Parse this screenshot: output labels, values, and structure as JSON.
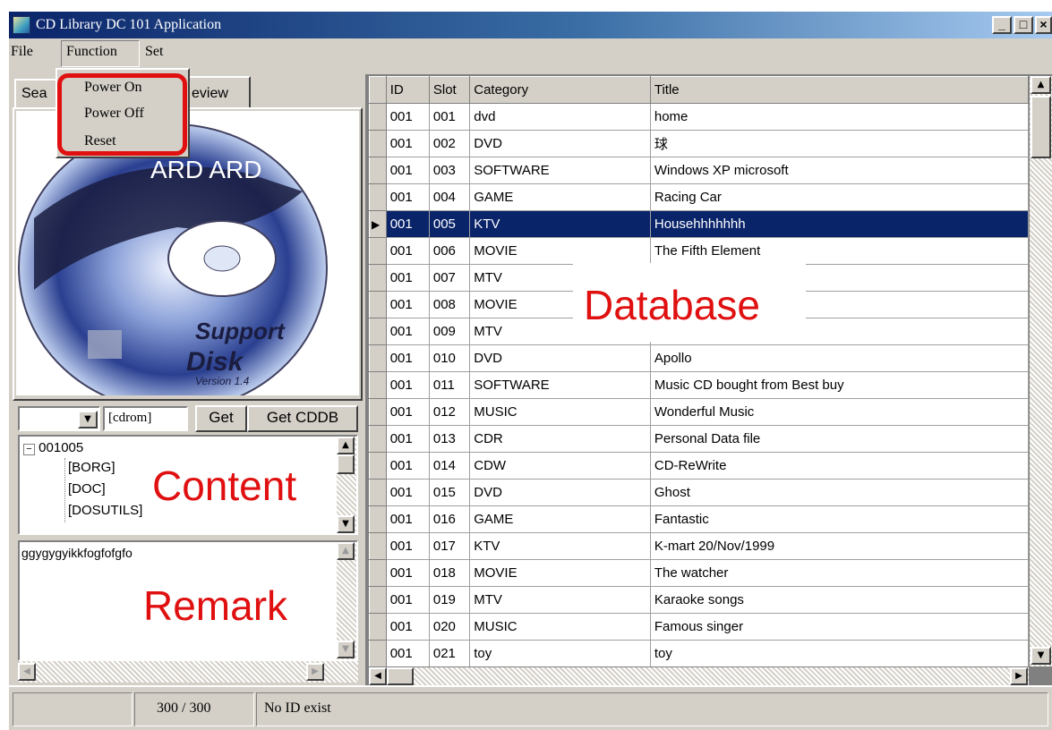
{
  "window": {
    "title": "CD Library DC 101 Application",
    "controls": {
      "minimize": "_",
      "maximize": "□",
      "close": "×"
    }
  },
  "menu": {
    "file": "File",
    "function": "Function",
    "set": "Set",
    "function_items": [
      "Power On",
      "Power Off",
      "Reset"
    ]
  },
  "left_panel": {
    "tab_search": "Sea",
    "tab_preview": "eview",
    "disc_image": {
      "brand": "ARD ARD",
      "text1": "Support",
      "text2": "Disk",
      "text3": "Version 1.4"
    },
    "drive_select": "",
    "drive_field": "[cdrom]",
    "get_button": "Get",
    "get_cddb_button": "Get CDDB",
    "tree": {
      "root": "001005",
      "children": [
        "[BORG]",
        "[DOC]",
        "[DOSUTILS]"
      ]
    },
    "content_label": "Content",
    "remark_text": "ggygygyikkfogfofgfo",
    "remark_label": "Remark"
  },
  "grid": {
    "columns": [
      "ID",
      "Slot",
      "Category",
      "Title"
    ],
    "selected_index": 4,
    "rows": [
      {
        "id": "001",
        "slot": "001",
        "category": "dvd",
        "title": "home"
      },
      {
        "id": "001",
        "slot": "002",
        "category": "DVD",
        "title": "球"
      },
      {
        "id": "001",
        "slot": "003",
        "category": "SOFTWARE",
        "title": "Windows XP microsoft"
      },
      {
        "id": "001",
        "slot": "004",
        "category": "GAME",
        "title": "Racing Car"
      },
      {
        "id": "001",
        "slot": "005",
        "category": "KTV",
        "title": "Househhhhhhh"
      },
      {
        "id": "001",
        "slot": "006",
        "category": "MOVIE",
        "title": "The Fifth Element"
      },
      {
        "id": "001",
        "slot": "007",
        "category": "MTV",
        "title": ""
      },
      {
        "id": "001",
        "slot": "008",
        "category": "MOVIE",
        "title": ""
      },
      {
        "id": "001",
        "slot": "009",
        "category": "MTV",
        "title": ""
      },
      {
        "id": "001",
        "slot": "010",
        "category": "DVD",
        "title": "Apollo"
      },
      {
        "id": "001",
        "slot": "011",
        "category": "SOFTWARE",
        "title": "Music CD bought from Best buy"
      },
      {
        "id": "001",
        "slot": "012",
        "category": "MUSIC",
        "title": "Wonderful Music"
      },
      {
        "id": "001",
        "slot": "013",
        "category": "CDR",
        "title": "Personal Data file"
      },
      {
        "id": "001",
        "slot": "014",
        "category": "CDW",
        "title": "CD-ReWrite"
      },
      {
        "id": "001",
        "slot": "015",
        "category": "DVD",
        "title": "Ghost"
      },
      {
        "id": "001",
        "slot": "016",
        "category": "GAME",
        "title": "Fantastic"
      },
      {
        "id": "001",
        "slot": "017",
        "category": "KTV",
        "title": "K-mart 20/Nov/1999"
      },
      {
        "id": "001",
        "slot": "018",
        "category": "MOVIE",
        "title": "The watcher"
      },
      {
        "id": "001",
        "slot": "019",
        "category": "MTV",
        "title": "Karaoke songs"
      },
      {
        "id": "001",
        "slot": "020",
        "category": "MUSIC",
        "title": "Famous singer"
      },
      {
        "id": "001",
        "slot": "021",
        "category": "toy",
        "title": "toy"
      }
    ],
    "database_label": "Database"
  },
  "status": {
    "cell1": "",
    "count": "300 / 300",
    "message": "No ID exist"
  },
  "colors": {
    "title_bar": "#0a246a",
    "selection": "#0a246a",
    "annotation_red": "#e01010",
    "face": "#d4d0c8"
  }
}
